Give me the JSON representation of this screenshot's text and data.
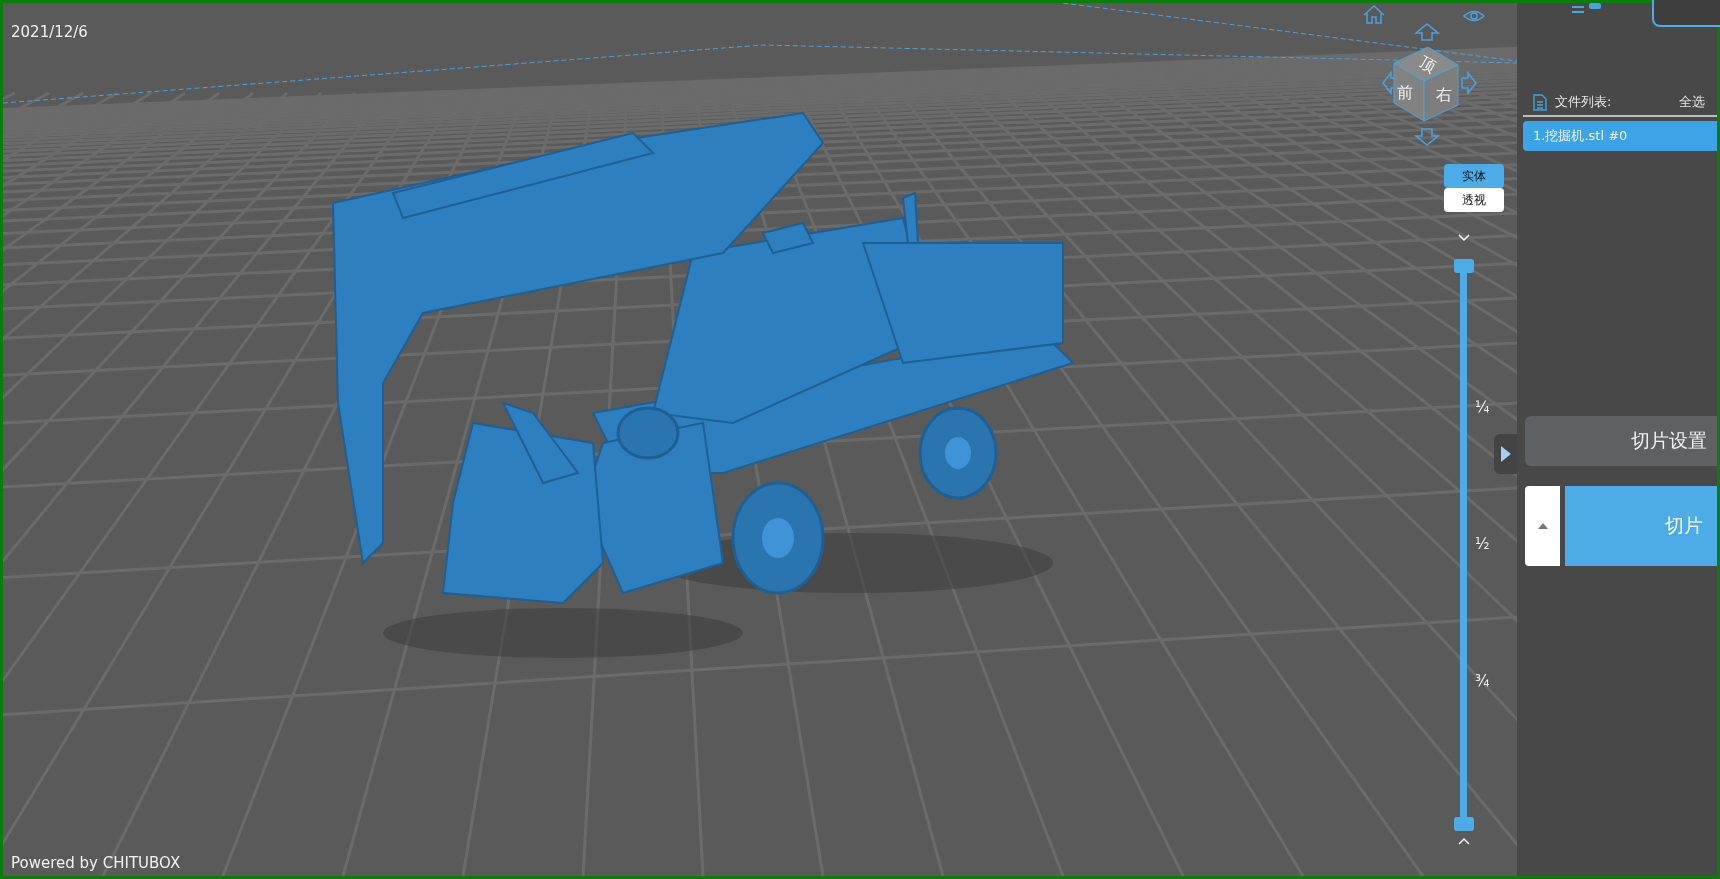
{
  "viewport": {
    "date": "2021/12/6",
    "footer": "Powered by CHITUBOX"
  },
  "view_cube": {
    "faces": [
      {
        "kind": "top",
        "label": "顶"
      },
      {
        "kind": "front",
        "label": "前"
      },
      {
        "kind": "right",
        "label": "右"
      }
    ]
  },
  "render_modes": [
    {
      "label": "实体",
      "selected": true
    },
    {
      "label": "透视",
      "selected": false
    }
  ],
  "layer_slider": {
    "level": 1,
    "ticks": [
      "¼",
      "½",
      "¾"
    ]
  },
  "file_panel": {
    "title": "文件列表:",
    "select_all": "全选",
    "files": [
      {
        "label": "1.挖掘机.stl #0",
        "selected": true
      }
    ]
  },
  "buttons": {
    "slice_settings": "切片设置",
    "slice": "切片"
  }
}
